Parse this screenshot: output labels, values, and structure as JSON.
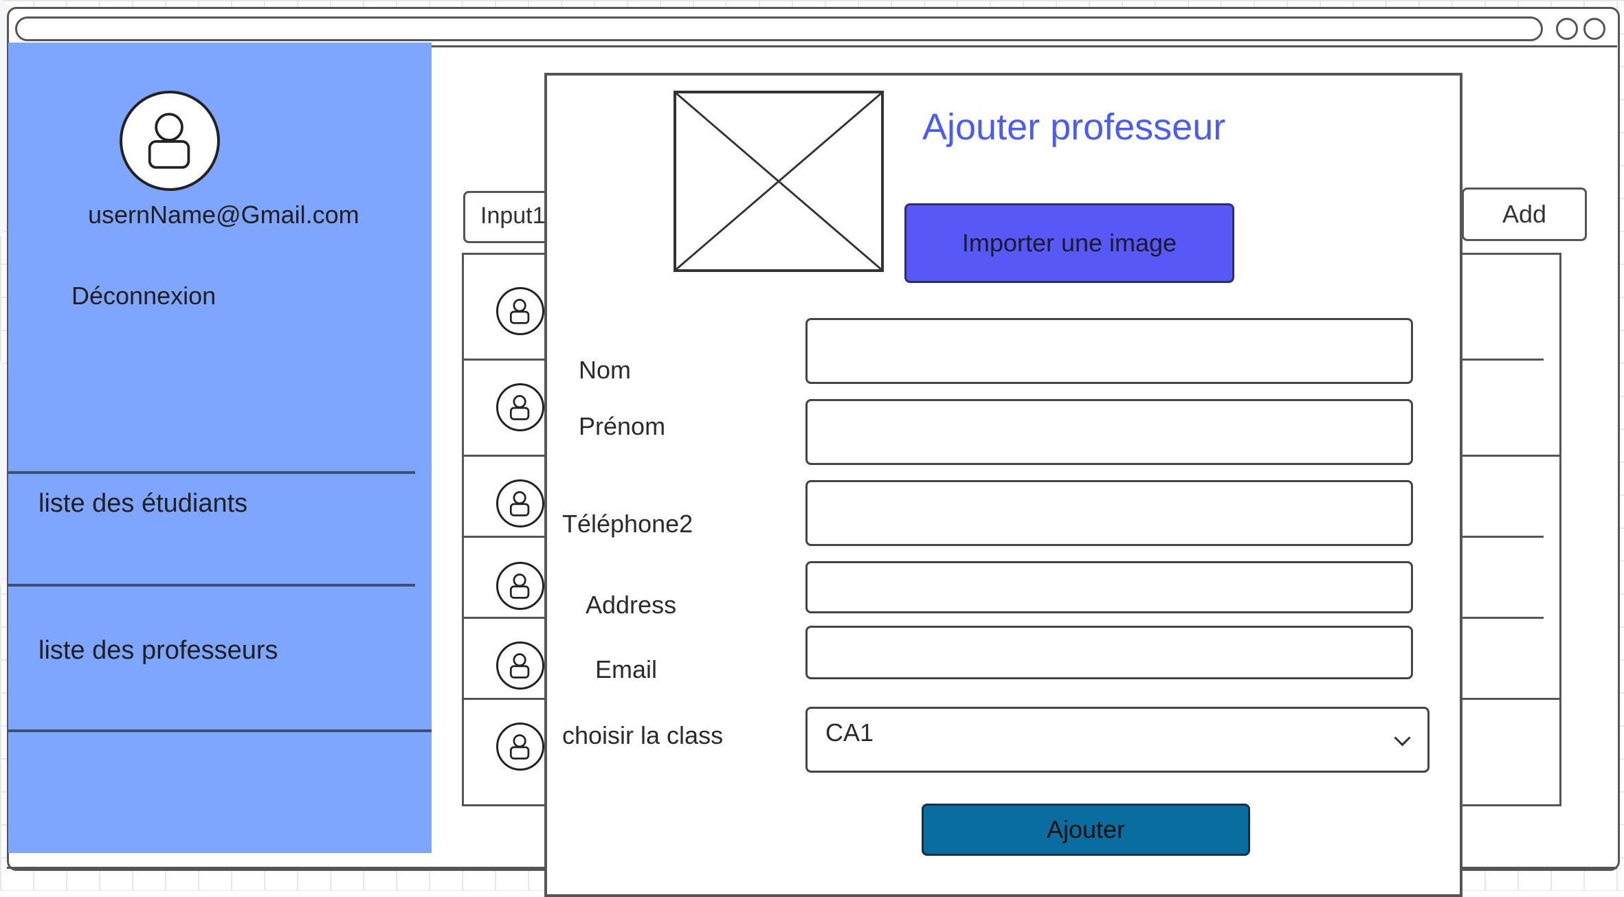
{
  "sidebar": {
    "email": "usernName@Gmail.com",
    "logout_label": "Déconnexion",
    "items": [
      {
        "label": "liste des étudiants"
      },
      {
        "label": "liste des professeurs"
      }
    ]
  },
  "main": {
    "search_input_value": "Input1",
    "add_button_label": "Add",
    "row_count": 6
  },
  "modal": {
    "title": "Ajouter professeur",
    "import_button_label": "Importer une  image",
    "fields": {
      "nom_label": "Nom",
      "prenom_label": "Prénom",
      "telephone_label": "Téléphone2",
      "address_label": "Address",
      "email_label": "Email",
      "class_label": "choisir la class"
    },
    "class_select_value": "CA1",
    "submit_label": "Ajouter"
  },
  "colors": {
    "sidebar_bg": "#7fa6fe",
    "title_color": "#4b5cf5",
    "import_button": "#5858f7",
    "submit_button": "#0a6d9f"
  }
}
